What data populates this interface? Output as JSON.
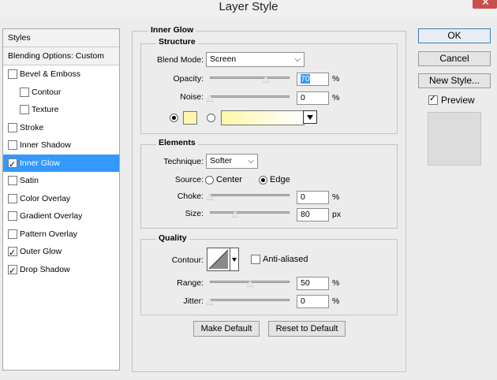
{
  "window": {
    "title": "Layer Style",
    "close_glyph": "✕"
  },
  "sidebar": {
    "header": "Styles",
    "blending": "Blending Options: Custom",
    "items": [
      {
        "label": "Bevel & Emboss",
        "checked": false,
        "indent": false
      },
      {
        "label": "Contour",
        "checked": false,
        "indent": true
      },
      {
        "label": "Texture",
        "checked": false,
        "indent": true
      },
      {
        "label": "Stroke",
        "checked": false,
        "indent": false
      },
      {
        "label": "Inner Shadow",
        "checked": false,
        "indent": false
      },
      {
        "label": "Inner Glow",
        "checked": true,
        "indent": false,
        "selected": true
      },
      {
        "label": "Satin",
        "checked": false,
        "indent": false
      },
      {
        "label": "Color Overlay",
        "checked": false,
        "indent": false
      },
      {
        "label": "Gradient Overlay",
        "checked": false,
        "indent": false
      },
      {
        "label": "Pattern Overlay",
        "checked": false,
        "indent": false
      },
      {
        "label": "Outer Glow",
        "checked": true,
        "indent": false
      },
      {
        "label": "Drop Shadow",
        "checked": true,
        "indent": false
      }
    ]
  },
  "panel": {
    "title": "Inner Glow",
    "structure": {
      "title": "Structure",
      "blend_mode_label": "Blend Mode:",
      "blend_mode_value": "Screen",
      "opacity_label": "Opacity:",
      "opacity_value": "70",
      "opacity_level": 0.7,
      "noise_label": "Noise:",
      "noise_value": "0",
      "noise_level": 0,
      "percent": "%",
      "glow_color": "#fff6b0"
    },
    "elements": {
      "title": "Elements",
      "technique_label": "Technique:",
      "technique_value": "Softer",
      "source_label": "Source:",
      "source_center": "Center",
      "source_edge": "Edge",
      "choke_label": "Choke:",
      "choke_value": "0",
      "choke_level": 0,
      "size_label": "Size:",
      "size_value": "80",
      "size_level": 0.32,
      "percent": "%",
      "px": "px"
    },
    "quality": {
      "title": "Quality",
      "contour_label": "Contour:",
      "anti_aliased_label": "Anti-aliased",
      "range_label": "Range:",
      "range_value": "50",
      "range_level": 0.5,
      "jitter_label": "Jitter:",
      "jitter_value": "0",
      "jitter_level": 0,
      "percent": "%"
    },
    "make_default": "Make Default",
    "reset_default": "Reset to Default"
  },
  "actions": {
    "ok": "OK",
    "cancel": "Cancel",
    "new_style": "New Style...",
    "preview_label": "Preview",
    "preview_checked": true
  }
}
